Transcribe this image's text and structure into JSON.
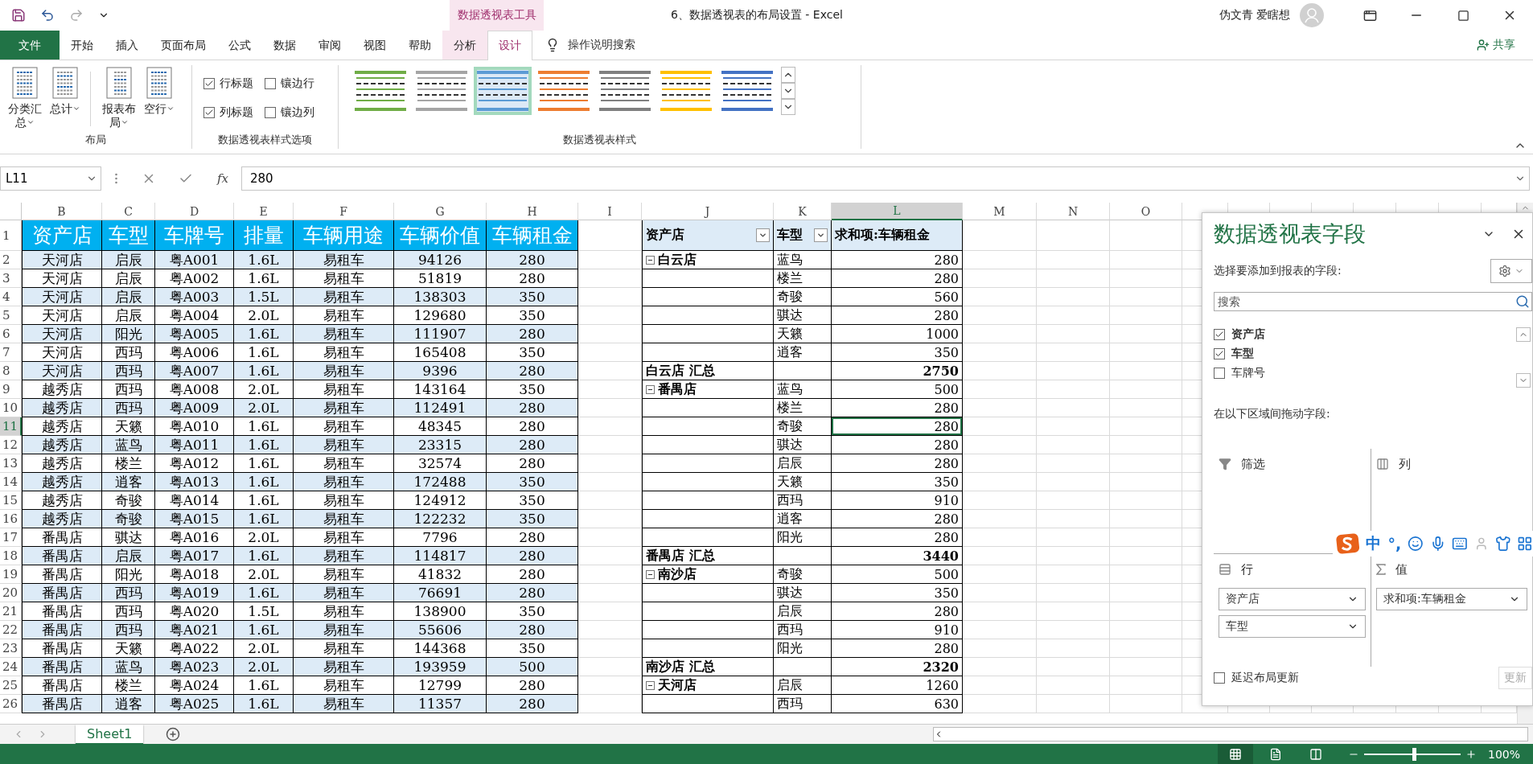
{
  "window": {
    "context_tab_group": "数据透视表工具",
    "title": "6、数据透视表的布局设置  -  Excel",
    "user": "伪文青 爱瞎想"
  },
  "tabs": [
    {
      "label": "文件",
      "kind": "file",
      "selected": false
    },
    {
      "label": "开始",
      "kind": "normal",
      "selected": false
    },
    {
      "label": "插入",
      "kind": "normal",
      "selected": false
    },
    {
      "label": "页面布局",
      "kind": "normal",
      "selected": false
    },
    {
      "label": "公式",
      "kind": "normal",
      "selected": false
    },
    {
      "label": "数据",
      "kind": "normal",
      "selected": false
    },
    {
      "label": "审阅",
      "kind": "normal",
      "selected": false
    },
    {
      "label": "视图",
      "kind": "normal",
      "selected": false
    },
    {
      "label": "帮助",
      "kind": "normal",
      "selected": false
    },
    {
      "label": "分析",
      "kind": "context",
      "selected": false
    },
    {
      "label": "设计",
      "kind": "context",
      "selected": true
    }
  ],
  "tell_me": "操作说明搜索",
  "share": "共享",
  "ribbon": {
    "layout_group": {
      "label": "布局",
      "buttons": [
        "分类汇总",
        "总计",
        "报表布局",
        "空行"
      ]
    },
    "options_group": {
      "label": "数据透视表样式选项",
      "checkboxes": [
        {
          "label": "行标题",
          "checked": true
        },
        {
          "label": "镶边行",
          "checked": false
        },
        {
          "label": "列标题",
          "checked": true
        },
        {
          "label": "镶边列",
          "checked": false
        }
      ]
    },
    "styles_group": {
      "label": "数据透视表样式",
      "styles": [
        {
          "color": "#70ad47",
          "selected": false
        },
        {
          "color": "#a5a5a5",
          "selected": false
        },
        {
          "color": "#5b9bd5",
          "selected": true
        },
        {
          "color": "#ed7d31",
          "selected": false
        },
        {
          "color": "#7f7f7f",
          "selected": false
        },
        {
          "color": "#ffc000",
          "selected": false
        },
        {
          "color": "#4472c4",
          "selected": false
        }
      ]
    }
  },
  "formula_bar": {
    "name_box": "L11",
    "function_label": "fx",
    "value": "280"
  },
  "sheet": {
    "columns": [
      {
        "label": "B",
        "selected": false
      },
      {
        "label": "C",
        "selected": false
      },
      {
        "label": "D",
        "selected": false
      },
      {
        "label": "E",
        "selected": false
      },
      {
        "label": "F",
        "selected": false
      },
      {
        "label": "G",
        "selected": false
      },
      {
        "label": "H",
        "selected": false
      },
      {
        "label": "I",
        "selected": false
      },
      {
        "label": "J",
        "selected": false
      },
      {
        "label": "K",
        "selected": false
      },
      {
        "label": "L",
        "selected": true
      },
      {
        "label": "M",
        "selected": false
      },
      {
        "label": "N",
        "selected": false
      },
      {
        "label": "O",
        "selected": false
      }
    ],
    "row_numbers": [
      {
        "label": "1",
        "selected": false
      },
      {
        "label": "2",
        "selected": false
      },
      {
        "label": "3",
        "selected": false
      },
      {
        "label": "4",
        "selected": false
      },
      {
        "label": "5",
        "selected": false
      },
      {
        "label": "6",
        "selected": false
      },
      {
        "label": "7",
        "selected": false
      },
      {
        "label": "8",
        "selected": false
      },
      {
        "label": "9",
        "selected": false
      },
      {
        "label": "10",
        "selected": false
      },
      {
        "label": "11",
        "selected": true
      },
      {
        "label": "12",
        "selected": false
      },
      {
        "label": "13",
        "selected": false
      },
      {
        "label": "14",
        "selected": false
      },
      {
        "label": "15",
        "selected": false
      },
      {
        "label": "16",
        "selected": false
      },
      {
        "label": "17",
        "selected": false
      },
      {
        "label": "18",
        "selected": false
      },
      {
        "label": "19",
        "selected": false
      },
      {
        "label": "20",
        "selected": false
      },
      {
        "label": "21",
        "selected": false
      },
      {
        "label": "22",
        "selected": false
      },
      {
        "label": "23",
        "selected": false
      },
      {
        "label": "24",
        "selected": false
      },
      {
        "label": "25",
        "selected": false
      },
      {
        "label": "26",
        "selected": false
      }
    ],
    "source_table": {
      "headers": [
        "资产店",
        "车型",
        "车牌号",
        "排量",
        "车辆用途",
        "车辆价值",
        "车辆租金"
      ],
      "rows": [
        [
          "天河店",
          "启辰",
          "粤A001",
          "1.6L",
          "易租车",
          "94126",
          "280"
        ],
        [
          "天河店",
          "启辰",
          "粤A002",
          "1.6L",
          "易租车",
          "51819",
          "280"
        ],
        [
          "天河店",
          "启辰",
          "粤A003",
          "1.5L",
          "易租车",
          "138303",
          "350"
        ],
        [
          "天河店",
          "启辰",
          "粤A004",
          "2.0L",
          "易租车",
          "129680",
          "350"
        ],
        [
          "天河店",
          "阳光",
          "粤A005",
          "1.6L",
          "易租车",
          "111907",
          "280"
        ],
        [
          "天河店",
          "西玛",
          "粤A006",
          "1.6L",
          "易租车",
          "165408",
          "350"
        ],
        [
          "天河店",
          "西玛",
          "粤A007",
          "1.6L",
          "易租车",
          "9396",
          "280"
        ],
        [
          "越秀店",
          "西玛",
          "粤A008",
          "2.0L",
          "易租车",
          "143164",
          "350"
        ],
        [
          "越秀店",
          "西玛",
          "粤A009",
          "2.0L",
          "易租车",
          "112491",
          "280"
        ],
        [
          "越秀店",
          "天籁",
          "粤A010",
          "1.6L",
          "易租车",
          "48345",
          "280"
        ],
        [
          "越秀店",
          "蓝鸟",
          "粤A011",
          "1.6L",
          "易租车",
          "23315",
          "280"
        ],
        [
          "越秀店",
          "楼兰",
          "粤A012",
          "1.6L",
          "易租车",
          "32574",
          "280"
        ],
        [
          "越秀店",
          "逍客",
          "粤A013",
          "1.6L",
          "易租车",
          "172488",
          "350"
        ],
        [
          "越秀店",
          "奇骏",
          "粤A014",
          "1.6L",
          "易租车",
          "124912",
          "350"
        ],
        [
          "越秀店",
          "奇骏",
          "粤A015",
          "1.6L",
          "易租车",
          "122232",
          "350"
        ],
        [
          "番禺店",
          "骐达",
          "粤A016",
          "2.0L",
          "易租车",
          "7796",
          "280"
        ],
        [
          "番禺店",
          "启辰",
          "粤A017",
          "1.6L",
          "易租车",
          "114817",
          "280"
        ],
        [
          "番禺店",
          "阳光",
          "粤A018",
          "2.0L",
          "易租车",
          "41832",
          "280"
        ],
        [
          "番禺店",
          "西玛",
          "粤A019",
          "1.6L",
          "易租车",
          "76691",
          "280"
        ],
        [
          "番禺店",
          "西玛",
          "粤A020",
          "1.5L",
          "易租车",
          "138900",
          "350"
        ],
        [
          "番禺店",
          "西玛",
          "粤A021",
          "1.6L",
          "易租车",
          "55606",
          "280"
        ],
        [
          "番禺店",
          "天籁",
          "粤A022",
          "2.0L",
          "易租车",
          "144368",
          "350"
        ],
        [
          "番禺店",
          "蓝鸟",
          "粤A023",
          "2.0L",
          "易租车",
          "193959",
          "500"
        ],
        [
          "番禺店",
          "楼兰",
          "粤A024",
          "1.6L",
          "易租车",
          "12799",
          "280"
        ],
        [
          "番禺店",
          "逍客",
          "粤A025",
          "1.6L",
          "易租车",
          "11357",
          "280"
        ]
      ]
    },
    "pivot_table": {
      "headers": [
        {
          "label": "资产店",
          "filter": true
        },
        {
          "label": "车型",
          "filter": true
        },
        {
          "label": "求和项:车辆租金",
          "filter": false
        }
      ],
      "rows": [
        {
          "kind": "group",
          "store": "白云店",
          "type": "蓝鸟",
          "value": "280",
          "selected": false
        },
        {
          "kind": "item",
          "type": "楼兰",
          "value": "280",
          "selected": false
        },
        {
          "kind": "item",
          "type": "奇骏",
          "value": "560",
          "selected": false
        },
        {
          "kind": "item",
          "type": "骐达",
          "value": "280",
          "selected": false
        },
        {
          "kind": "item",
          "type": "天籁",
          "value": "1000",
          "selected": false
        },
        {
          "kind": "item",
          "type": "逍客",
          "value": "350",
          "selected": false
        },
        {
          "kind": "total",
          "store": "白云店  汇总",
          "value": "2750",
          "selected": false
        },
        {
          "kind": "group",
          "store": "番禺店",
          "type": "蓝鸟",
          "value": "500",
          "selected": false
        },
        {
          "kind": "item",
          "type": "楼兰",
          "value": "280",
          "selected": false
        },
        {
          "kind": "item",
          "type": "奇骏",
          "value": "280",
          "selected": true
        },
        {
          "kind": "item",
          "type": "骐达",
          "value": "280",
          "selected": false
        },
        {
          "kind": "item",
          "type": "启辰",
          "value": "280",
          "selected": false
        },
        {
          "kind": "item",
          "type": "天籁",
          "value": "350",
          "selected": false
        },
        {
          "kind": "item",
          "type": "西玛",
          "value": "910",
          "selected": false
        },
        {
          "kind": "item",
          "type": "逍客",
          "value": "280",
          "selected": false
        },
        {
          "kind": "item",
          "type": "阳光",
          "value": "280",
          "selected": false
        },
        {
          "kind": "total",
          "store": "番禺店  汇总",
          "value": "3440",
          "selected": false
        },
        {
          "kind": "group",
          "store": "南沙店",
          "type": "奇骏",
          "value": "500",
          "selected": false
        },
        {
          "kind": "item",
          "type": "骐达",
          "value": "350",
          "selected": false
        },
        {
          "kind": "item",
          "type": "启辰",
          "value": "280",
          "selected": false
        },
        {
          "kind": "item",
          "type": "西玛",
          "value": "910",
          "selected": false
        },
        {
          "kind": "item",
          "type": "阳光",
          "value": "280",
          "selected": false
        },
        {
          "kind": "total",
          "store": "南沙店  汇总",
          "value": "2320",
          "selected": false
        },
        {
          "kind": "group",
          "store": "天河店",
          "type": "启辰",
          "value": "1260",
          "selected": false
        },
        {
          "kind": "item",
          "type": "西玛",
          "value": "630",
          "selected": false
        }
      ]
    }
  },
  "field_pane": {
    "title": "数据透视表字段",
    "prompt": "选择要添加到报表的字段:",
    "search_placeholder": "搜索",
    "fields": [
      {
        "label": "资产店",
        "checked": true
      },
      {
        "label": "车型",
        "checked": true
      },
      {
        "label": "车牌号",
        "checked": false
      }
    ],
    "drag_prompt": "在以下区域间拖动字段:",
    "areas": [
      {
        "kind": "filter",
        "label": "筛选"
      },
      {
        "kind": "columns",
        "label": "列"
      },
      {
        "kind": "rows",
        "label": "行",
        "items": [
          "资产店",
          "车型"
        ]
      },
      {
        "kind": "values",
        "label": "值",
        "items": [
          "求和项:车辆租金"
        ]
      }
    ],
    "defer_update": {
      "label": "延迟布局更新",
      "checked": false
    },
    "update_button": {
      "label": "更新",
      "disabled": true
    }
  },
  "ime_toolbar": {
    "mode": "中",
    "punctuation": "°,"
  },
  "sheet_tabs": [
    {
      "label": "Sheet1",
      "selected": true
    }
  ],
  "status_bar": {
    "views": [
      {
        "kind": "normal",
        "selected": true
      },
      {
        "kind": "page_layout",
        "selected": false
      },
      {
        "kind": "page_break",
        "selected": false
      }
    ],
    "zoom_slider": {
      "level": 0.52
    },
    "zoom": "100%"
  }
}
